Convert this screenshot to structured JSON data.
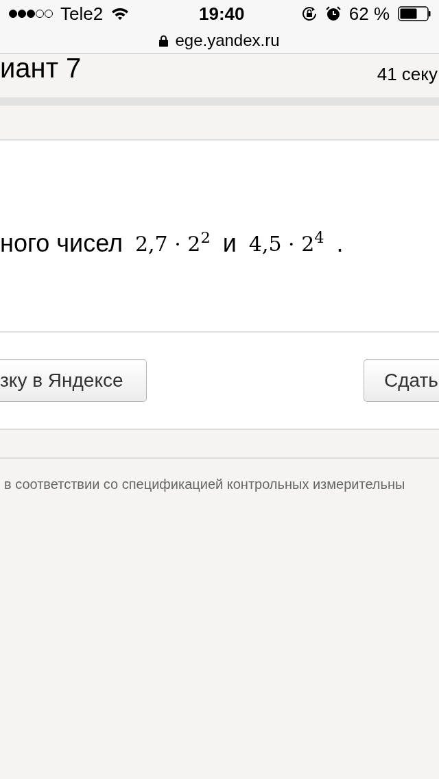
{
  "status_bar": {
    "carrier": "Tele2",
    "time": "19:40",
    "battery_percent": "62 %"
  },
  "address_bar": {
    "url": "ege.yandex.ru"
  },
  "header": {
    "title": "иант 7",
    "timer": "41 секу"
  },
  "task": {
    "segments": [
      {
        "kind": "text",
        "text": "ного чисел"
      },
      {
        "kind": "math",
        "text": "2,7 · 2$^{2}$"
      },
      {
        "kind": "text",
        "text": "и"
      },
      {
        "kind": "math",
        "text": "4,5 · 2$^{4}$"
      },
      {
        "kind": "text",
        "text": "."
      }
    ]
  },
  "buttons": [
    {
      "label": "зку в Яндексе"
    },
    {
      "label": "Сдать"
    }
  ],
  "footer": {
    "text": "в соответствии со спецификацией контрольных измерительны"
  }
}
